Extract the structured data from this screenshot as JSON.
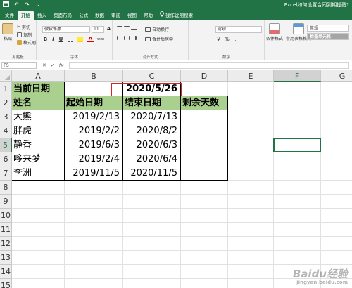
{
  "window": {
    "title": "Excel如何设置合同到期提醒?",
    "qat": [
      "save-icon",
      "undo-icon",
      "redo-icon",
      "customize-icon"
    ]
  },
  "tabs": [
    "文件",
    "开始",
    "插入",
    "页面布局",
    "公式",
    "数据",
    "审阅",
    "视图",
    "帮助",
    "操作说明搜索"
  ],
  "active_tab": "开始",
  "ribbon": {
    "clipboard": {
      "label": "剪贴板",
      "paste": "粘贴",
      "cut": "剪切",
      "copy": "复制",
      "painter": "格式刷"
    },
    "font": {
      "label": "字体",
      "name": "微软雅黑",
      "size": "11",
      "bold": "B",
      "italic": "I",
      "underline": "U",
      "grow": "A",
      "shrink": "A",
      "color_letter": "A",
      "phonetic": "wén"
    },
    "alignment": {
      "label": "对齐方式",
      "wrap": "自动换行",
      "merge": "合并后居中"
    },
    "number": {
      "label": "数字",
      "format": "常规",
      "percent": "%",
      "comma": ",",
      "currency": "¥"
    },
    "styles": {
      "conditional": "条件格式",
      "table": "套用表格格式",
      "normal": "常规",
      "check": "检查单元格"
    }
  },
  "formula_bar": {
    "name_box": "F5",
    "fx": "fx",
    "content": ""
  },
  "columns": [
    "A",
    "B",
    "C",
    "D",
    "E",
    "F",
    "G"
  ],
  "rows": [
    "1",
    "2",
    "3",
    "4",
    "5",
    "6",
    "7",
    "8",
    "9",
    "10",
    "11",
    "12",
    "13",
    "14",
    "15"
  ],
  "selected_cell": "F5",
  "sheet": {
    "current_date_label": "当前日期",
    "current_date": "2020/5/26",
    "headers": [
      "姓名",
      "起始日期",
      "结束日期",
      "剩余天数"
    ],
    "records": [
      [
        "大熊",
        "2019/2/13",
        "2020/7/13",
        ""
      ],
      [
        "胖虎",
        "2019/2/2",
        "2020/8/2",
        ""
      ],
      [
        "静香",
        "2019/6/3",
        "2020/6/3",
        ""
      ],
      [
        "哆来梦",
        "2019/2/4",
        "2020/6/4",
        ""
      ],
      [
        "李洲",
        "2019/11/5",
        "2020/11/5",
        ""
      ]
    ]
  },
  "watermark": {
    "text": "Baidu经验",
    "sub": "jingyan.baidu.com"
  },
  "colors": {
    "excel_green": "#217346",
    "header_fill": "#a9d08e",
    "date_frame": "#d02828"
  }
}
